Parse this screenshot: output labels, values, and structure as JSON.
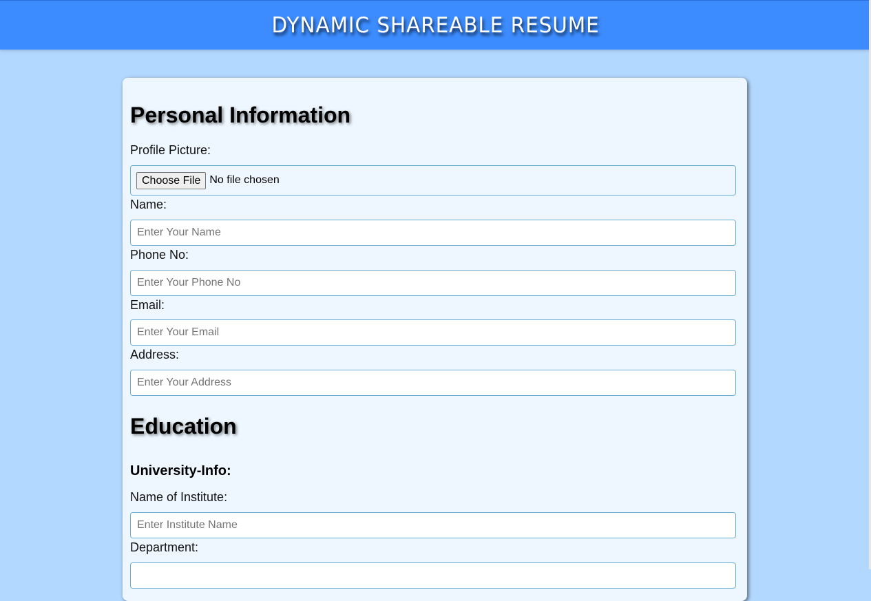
{
  "header": {
    "title": "DYNAMIC SHAREABLE RESUME"
  },
  "personal": {
    "heading": "Personal Information",
    "profile_label": "Profile Picture:",
    "file_button": "Choose File",
    "file_status": "No file chosen",
    "name_label": "Name:",
    "name_placeholder": "Enter Your Name",
    "name_value": "",
    "phone_label": "Phone No:",
    "phone_placeholder": "Enter Your Phone No",
    "phone_value": "",
    "email_label": "Email:",
    "email_placeholder": "Enter Your Email",
    "email_value": "",
    "address_label": "Address:",
    "address_placeholder": "Enter Your Address",
    "address_value": ""
  },
  "education": {
    "heading": "Education",
    "subheading": "University-Info:",
    "institute_label": "Name of Institute:",
    "institute_placeholder": "Enter Institute Name",
    "institute_value": "",
    "department_label": "Department:"
  },
  "colors": {
    "header_bg": "#3c8cff",
    "page_bg": "#b3d8ff",
    "card_bg": "#eef7ff",
    "input_border": "#6aaed6"
  }
}
